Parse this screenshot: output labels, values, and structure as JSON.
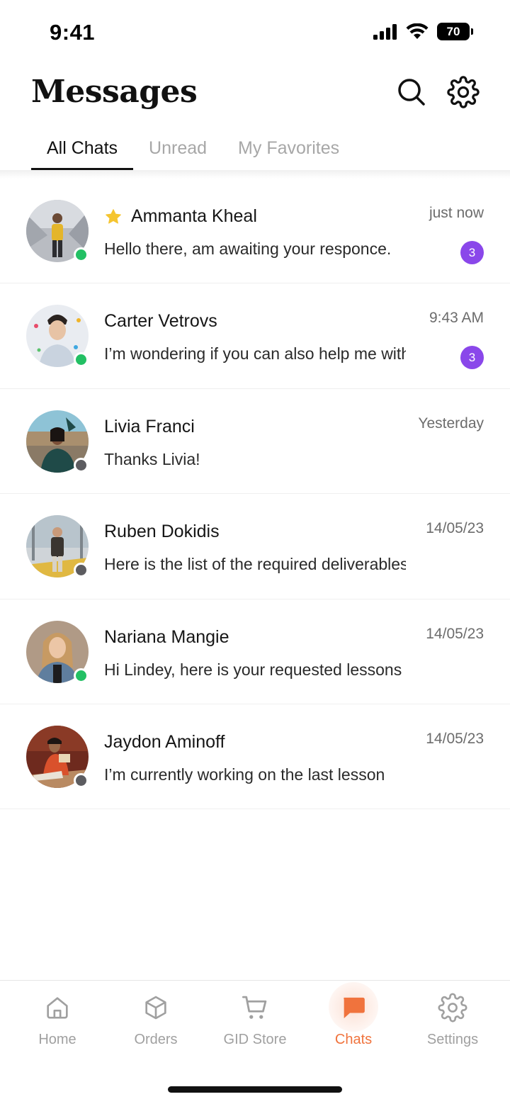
{
  "status_bar": {
    "time": "9:41",
    "battery": "70"
  },
  "header": {
    "title": "Messages",
    "search_icon": "search-icon",
    "settings_icon": "gear-icon"
  },
  "tabs": [
    {
      "label": "All Chats",
      "active": true
    },
    {
      "label": "Unread",
      "active": false
    },
    {
      "label": "My Favorites",
      "active": false
    }
  ],
  "chats": [
    {
      "name": "Ammanta Kheal",
      "favorite": true,
      "preview": "Hello there, am awaiting your responce.",
      "time": "just now",
      "unread": "3",
      "online": true
    },
    {
      "name": "Carter Vetrovs",
      "favorite": false,
      "preview": "I’m wondering if you can also help me with",
      "time": "9:43 AM",
      "unread": "3",
      "online": true
    },
    {
      "name": "Livia Franci",
      "favorite": false,
      "preview": "Thanks Livia!",
      "time": "Yesterday",
      "unread": "",
      "online": false
    },
    {
      "name": "Ruben Dokidis",
      "favorite": false,
      "preview": "Here is the list of the required deliverables",
      "time": "14/05/23",
      "unread": "",
      "online": false
    },
    {
      "name": "Nariana Mangie",
      "favorite": false,
      "preview": "Hi Lindey, here is your requested lessons",
      "time": "14/05/23",
      "unread": "",
      "online": true
    },
    {
      "name": "Jaydon Aminoff",
      "favorite": false,
      "preview": "I’m currently working on the last lesson",
      "time": "14/05/23",
      "unread": "",
      "online": false
    }
  ],
  "bottom_nav": [
    {
      "label": "Home",
      "icon": "home-icon",
      "active": false
    },
    {
      "label": "Orders",
      "icon": "box-icon",
      "active": false
    },
    {
      "label": "GID Store",
      "icon": "cart-icon",
      "active": false
    },
    {
      "label": "Chats",
      "icon": "chat-bubble-icon",
      "active": true
    },
    {
      "label": "Settings",
      "icon": "gear-icon",
      "active": false
    }
  ],
  "colors": {
    "accent": "#f0733d",
    "badge": "#8a47ea",
    "online": "#23c064",
    "offline": "#5c5c60",
    "star": "#f5c531"
  }
}
